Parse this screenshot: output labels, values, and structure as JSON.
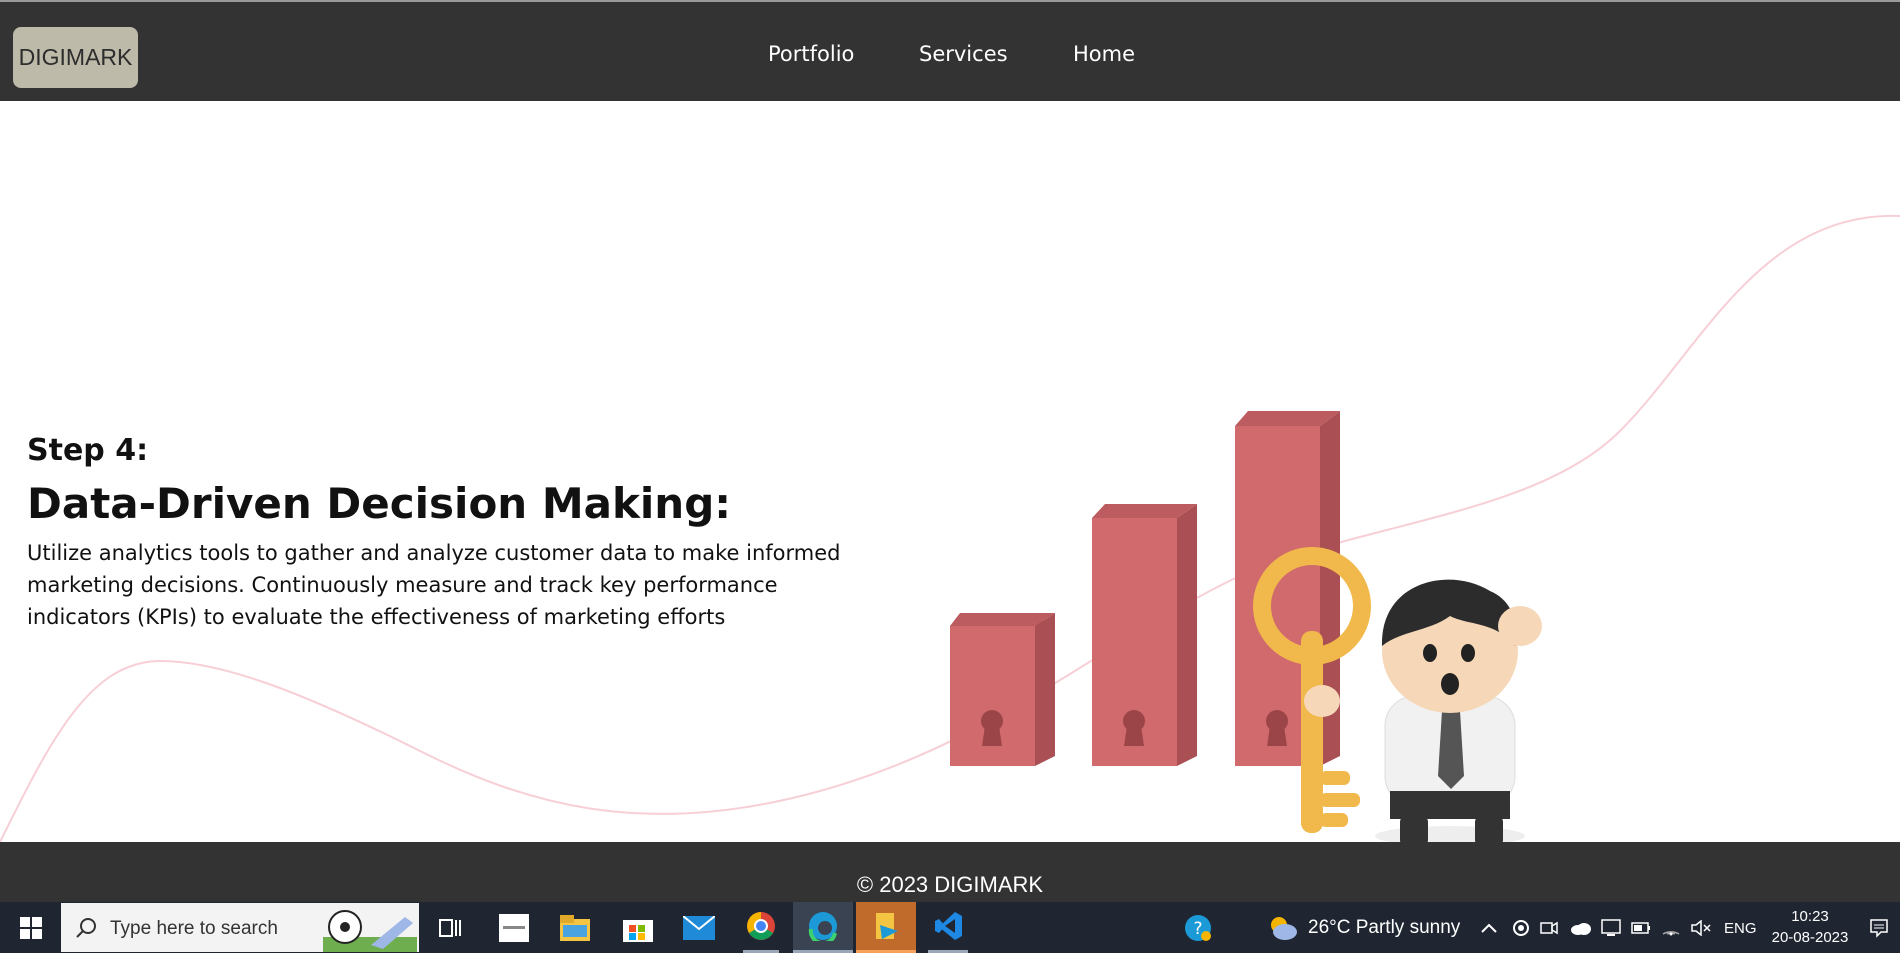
{
  "nav": {
    "logo": "DIGIMARK",
    "links": [
      "Portfolio",
      "Services",
      "Home"
    ]
  },
  "hero": {
    "step": "Step 4:",
    "title": "Data-Driven Decision Making:",
    "description": "Utilize analytics tools to gather and analyze customer data to make informed marketing decisions. Continuously measure and track key performance indicators (KPIs) to evaluate the effectiveness of marketing efforts"
  },
  "footer": {
    "copyright": "© 2023 DIGIMARK"
  },
  "taskbar": {
    "search_placeholder": "Type here to search",
    "weather": "26°C  Partly sunny",
    "language": "ENG",
    "time": "10:23",
    "date": "20-08-2023"
  },
  "colors": {
    "navbar_bg": "#333333",
    "logo_bg": "#bdbaa9",
    "bar_color": "#d06a6d",
    "key_color": "#f1b84b",
    "taskbar_bg": "#1f2632"
  }
}
